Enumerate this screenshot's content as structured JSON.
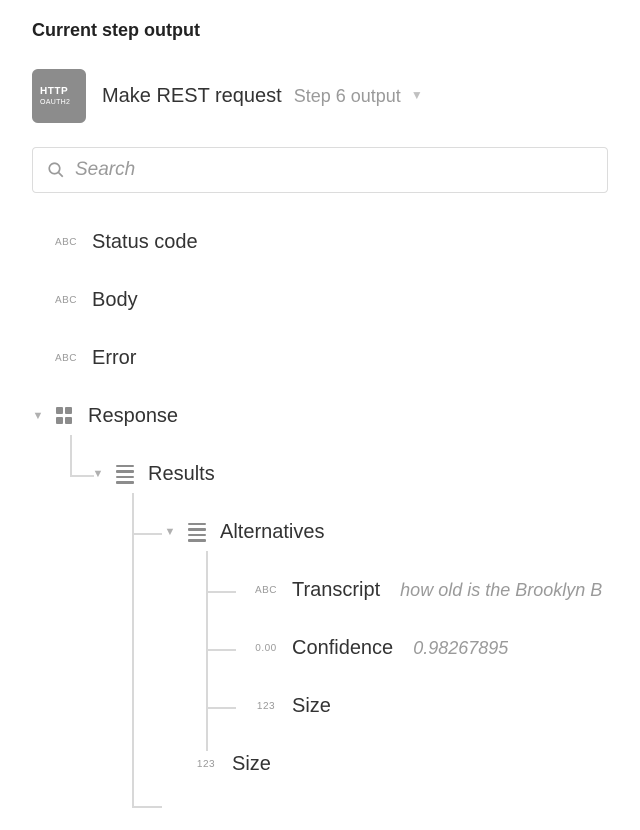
{
  "header": {
    "title": "Current step output"
  },
  "step": {
    "badge": {
      "line1": "HTTP",
      "line2": "OAUTH2"
    },
    "title": "Make REST request",
    "subtitle": "Step 6 output"
  },
  "search": {
    "placeholder": "Search"
  },
  "type_labels": {
    "abc": "ABC",
    "zero": "0.00",
    "num": "123"
  },
  "tree": {
    "status_code": {
      "label": "Status code"
    },
    "body": {
      "label": "Body"
    },
    "error": {
      "label": "Error"
    },
    "response": {
      "label": "Response",
      "results": {
        "label": "Results",
        "alternatives": {
          "label": "Alternatives",
          "transcript": {
            "label": "Transcript",
            "value": "how old is the Brooklyn B"
          },
          "confidence": {
            "label": "Confidence",
            "value": "0.98267895"
          },
          "size_inner": {
            "label": "Size"
          }
        },
        "size_outer": {
          "label": "Size"
        }
      }
    }
  }
}
